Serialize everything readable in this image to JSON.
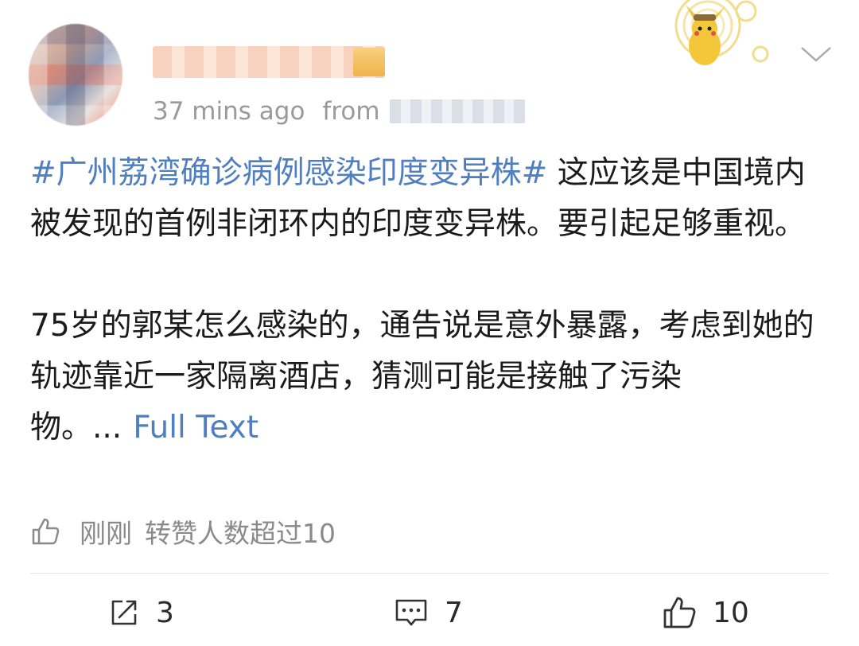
{
  "post": {
    "time": "37 mins ago",
    "from_label": "from",
    "hashtag": "#广州荔湾确诊病例感染印度变异株#",
    "para1_rest": " 这应该是中国境内被发现的首例非闭环内的印度变异株。要引起足够重视。",
    "para2": "75岁的郭某怎么感染的，通告说是意外暴露，考虑到她的轨迹靠近一家隔离酒店，猜测可能是接触了污染物。...",
    "full_text_link": "Full Text",
    "likes_time": "刚刚",
    "likes_text": "转赞人数超过10"
  },
  "actions": {
    "repost_count": "3",
    "comment_count": "7",
    "like_count": "10"
  },
  "icons": {
    "menu": "chevron-down-icon",
    "likes": "thumb-up-outline-icon",
    "repost": "share-box-icon",
    "comment": "comment-bubble-icon",
    "like": "thumb-up-icon"
  },
  "colors": {
    "link": "#4f7fc0",
    "meta": "#9a9a9a",
    "text": "#1b1b1b"
  }
}
